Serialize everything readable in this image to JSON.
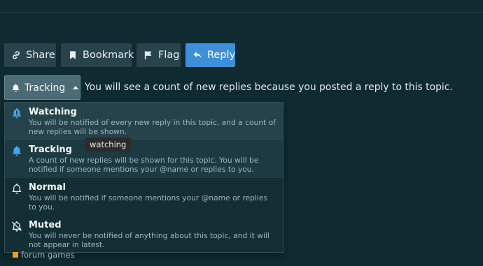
{
  "actions": {
    "share_label": "Share",
    "bookmark_label": "Bookmark",
    "flag_label": "Flag",
    "reply_label": "Reply"
  },
  "notifications": {
    "current_level": "Tracking",
    "reason": "You will see a count of new replies because you posted a reply to this topic.",
    "options": [
      {
        "title": "Watching",
        "description": "You will be notified of every new reply in this topic, and a count of new replies will be shown.",
        "icon": "bell-exclamation-icon"
      },
      {
        "title": "Tracking",
        "description": "A count of new replies will be shown for this topic. You will be notified if someone mentions your @name or replies to you.",
        "icon": "bell-icon"
      },
      {
        "title": "Normal",
        "description": "You will be notified if someone mentions your @name or replies to you.",
        "icon": "bell-outline-icon"
      },
      {
        "title": "Muted",
        "description": "You will never be notified of anything about this topic, and it will not appear in latest.",
        "icon": "bell-slash-icon"
      }
    ]
  },
  "tooltip": "watching",
  "category": {
    "name": "forum games",
    "color": "#e3a02b"
  },
  "colors": {
    "background": "#0f2a31",
    "primary": "#3f8fd6",
    "icon_blue": "#4aa3e8"
  }
}
